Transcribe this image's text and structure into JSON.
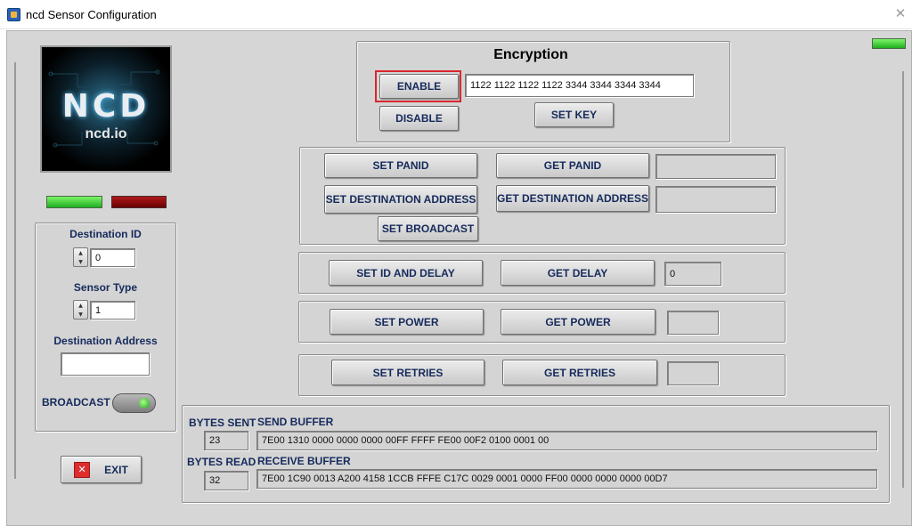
{
  "window": {
    "title": "ncd Sensor Configuration",
    "close_glyph": "✕"
  },
  "logo": {
    "mark": "NCD",
    "subtitle": "ncd.io"
  },
  "encryption": {
    "title": "Encryption",
    "enable_label": "ENABLE",
    "disable_label": "DISABLE",
    "key_value": "1122 1122 1122 1122 3344 3344 3344 3344",
    "set_key_label": "SET KEY"
  },
  "panid": {
    "set_panid_label": "SET PANID",
    "get_panid_label": "GET PANID",
    "panid_value": "",
    "set_dest_label": "SET DESTINATION ADDRESS",
    "get_dest_label": "GET DESTINATION ADDRESS",
    "dest_value": "",
    "set_broadcast_label": "SET BROADCAST"
  },
  "delay": {
    "set_label": "SET ID AND DELAY",
    "get_label": "GET DELAY",
    "value": "0"
  },
  "power": {
    "set_label": "SET POWER",
    "get_label": "GET POWER",
    "value": ""
  },
  "retries": {
    "set_label": "SET RETRIES",
    "get_label": "GET RETRIES",
    "value": ""
  },
  "sidebar": {
    "destination_id_label": "Destination ID",
    "destination_id_value": "0",
    "sensor_type_label": "Sensor Type",
    "sensor_type_value": "1",
    "destination_address_label": "Destination Address",
    "destination_address_value": "",
    "broadcast_label": "BROADCAST",
    "exit_label": "EXIT"
  },
  "buffers": {
    "bytes_sent_label": "BYTES SENT",
    "bytes_sent_value": "23",
    "send_buffer_label": "SEND BUFFER",
    "send_buffer_value": "7E00 1310 0000 0000 0000 00FF FFFF FE00 00F2 0100 0001 00",
    "bytes_read_label": "BYTES READ",
    "bytes_read_value": "32",
    "receive_buffer_label": "RECEIVE BUFFER",
    "receive_buffer_value": "7E00 1C90 0013 A200 4158 1CCB FFFE C17C 0029 0001 0000 FF00 0000 0000 0000 00D7"
  },
  "indicators": {
    "top_right": "green",
    "left": "green",
    "right": "red"
  },
  "colors": {
    "label_navy": "#152a5c",
    "enable_outline": "#d8262e",
    "led_green": "#3ad63a",
    "led_red": "#8a0d0d"
  },
  "icons": {
    "app": "labview-app-icon",
    "close": "close-icon",
    "exit": "exit-x-icon",
    "spinner": "spinner-arrows-icon",
    "toggle": "toggle-switch-icon"
  }
}
